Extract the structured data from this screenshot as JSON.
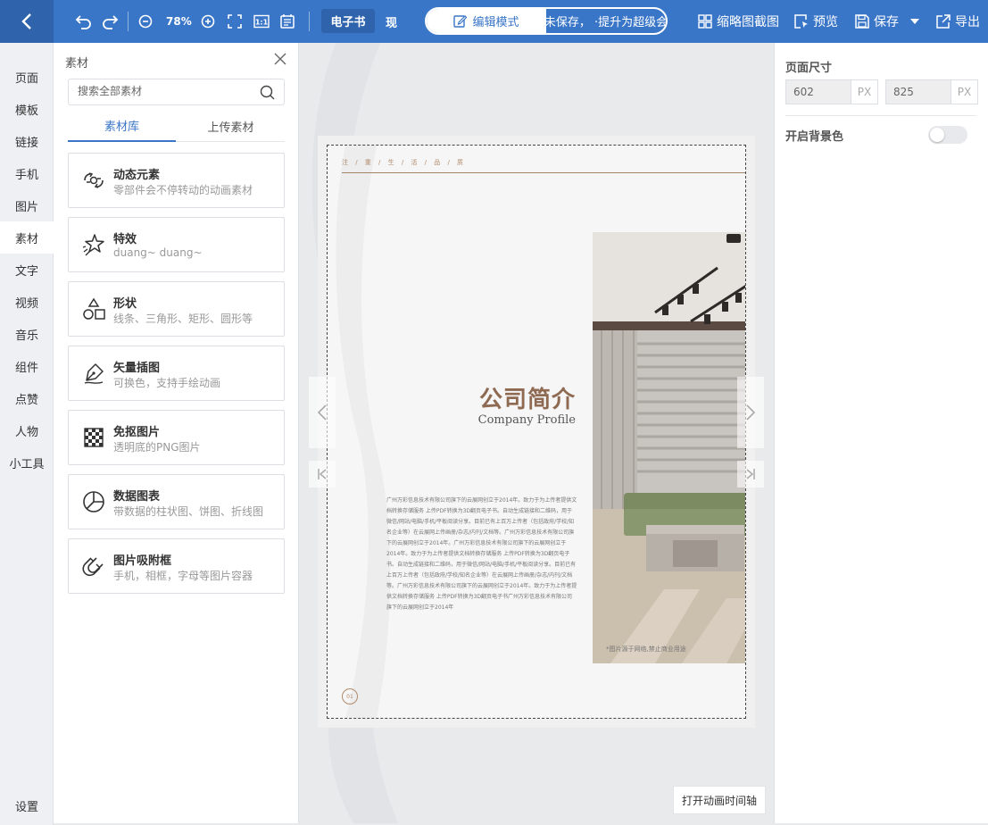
{
  "toolbar": {
    "zoom": "78%",
    "tag_ebook": "电子书",
    "tag_present": "现",
    "mode_edit": "编辑模式",
    "mode_other": "作未保存，   ·提升为超级会员",
    "thumbnail": "缩略图截图",
    "preview": "预览",
    "save": "保存",
    "export": "导出"
  },
  "nav": {
    "items": [
      "页面",
      "模板",
      "链接",
      "手机",
      "图片",
      "素材",
      "文字",
      "视频",
      "音乐",
      "组件",
      "点赞",
      "人物",
      "小工具"
    ],
    "settings": "设置"
  },
  "panel": {
    "title": "素材",
    "search_placeholder": "搜索全部素材",
    "tab_library": "素材库",
    "tab_upload": "上传素材",
    "cards": [
      {
        "title": "动态元素",
        "desc": "零部件会不停转动的动画素材",
        "icon": "gear-animation-icon"
      },
      {
        "title": "特效",
        "desc": "duang~ duang~",
        "icon": "sparkle-star-icon"
      },
      {
        "title": "形状",
        "desc": "线条、三角形、矩形、圆形等",
        "icon": "shapes-icon"
      },
      {
        "title": "矢量插图",
        "desc": "可换色，支持手绘动画",
        "icon": "pen-nib-icon"
      },
      {
        "title": "免抠图片",
        "desc": "透明底的PNG图片",
        "icon": "checkerboard-icon"
      },
      {
        "title": "数据图表",
        "desc": "带数据的柱状图、饼图、折线图",
        "icon": "pie-chart-icon"
      },
      {
        "title": "图片吸附框",
        "desc": "手机，相框，字母等图片容器",
        "icon": "magnet-icon"
      }
    ]
  },
  "page": {
    "header": "注 / 重 / 生 / 活 / 品 / 质",
    "title_cn": "公司简介",
    "title_en": "Company Profile",
    "body": "广州万彩信息技术有限公司旗下的云展网创立于2014年。致力于为上传者提供文档转换存储服务 上传PDF转换为3D翻页电子书。自动生成链接和二维码，用于微信/网站/电脑/手机/平板阅读分享。目前已有上百万上传者（包括政府/学校/知名企业等）在云展网上传画册/杂志/内刊/文档等。广州万彩信息技术有限公司旗下的云展网创立于2014年。广州万彩信息技术有限公司旗下的云展网创立于2014年。致力于为上传者提供文档转换存储服务 上传PDF转换为3D翻页电子书。自动生成链接和二维码，用于微信/网站/电脑/手机/平板阅读分享。目前已有上百万上传者（包括政府/学校/知名企业等）在云展网上传画册/杂志/内刊/文档等。广州万彩信息技术有限公司旗下的云展网创立于2014年。致力于为上传者提供文档转换存储服务 上传PDF转换为3D翻页电子书广州万彩信息技术有限公司旗下的云展网创立于2014年",
    "credit": "*图片源于网络,禁止商业用途",
    "page_number": "01"
  },
  "timeline_button": "打开动画时间轴",
  "right_panel": {
    "size_label": "页面尺寸",
    "width": "602",
    "height": "825",
    "unit": "PX",
    "bg_label": "开启背景色",
    "bg_enabled": false
  },
  "colors": {
    "primary": "#3a76c7",
    "primary_dark": "#2f64ad",
    "accent_brown": "#8f6a52"
  }
}
